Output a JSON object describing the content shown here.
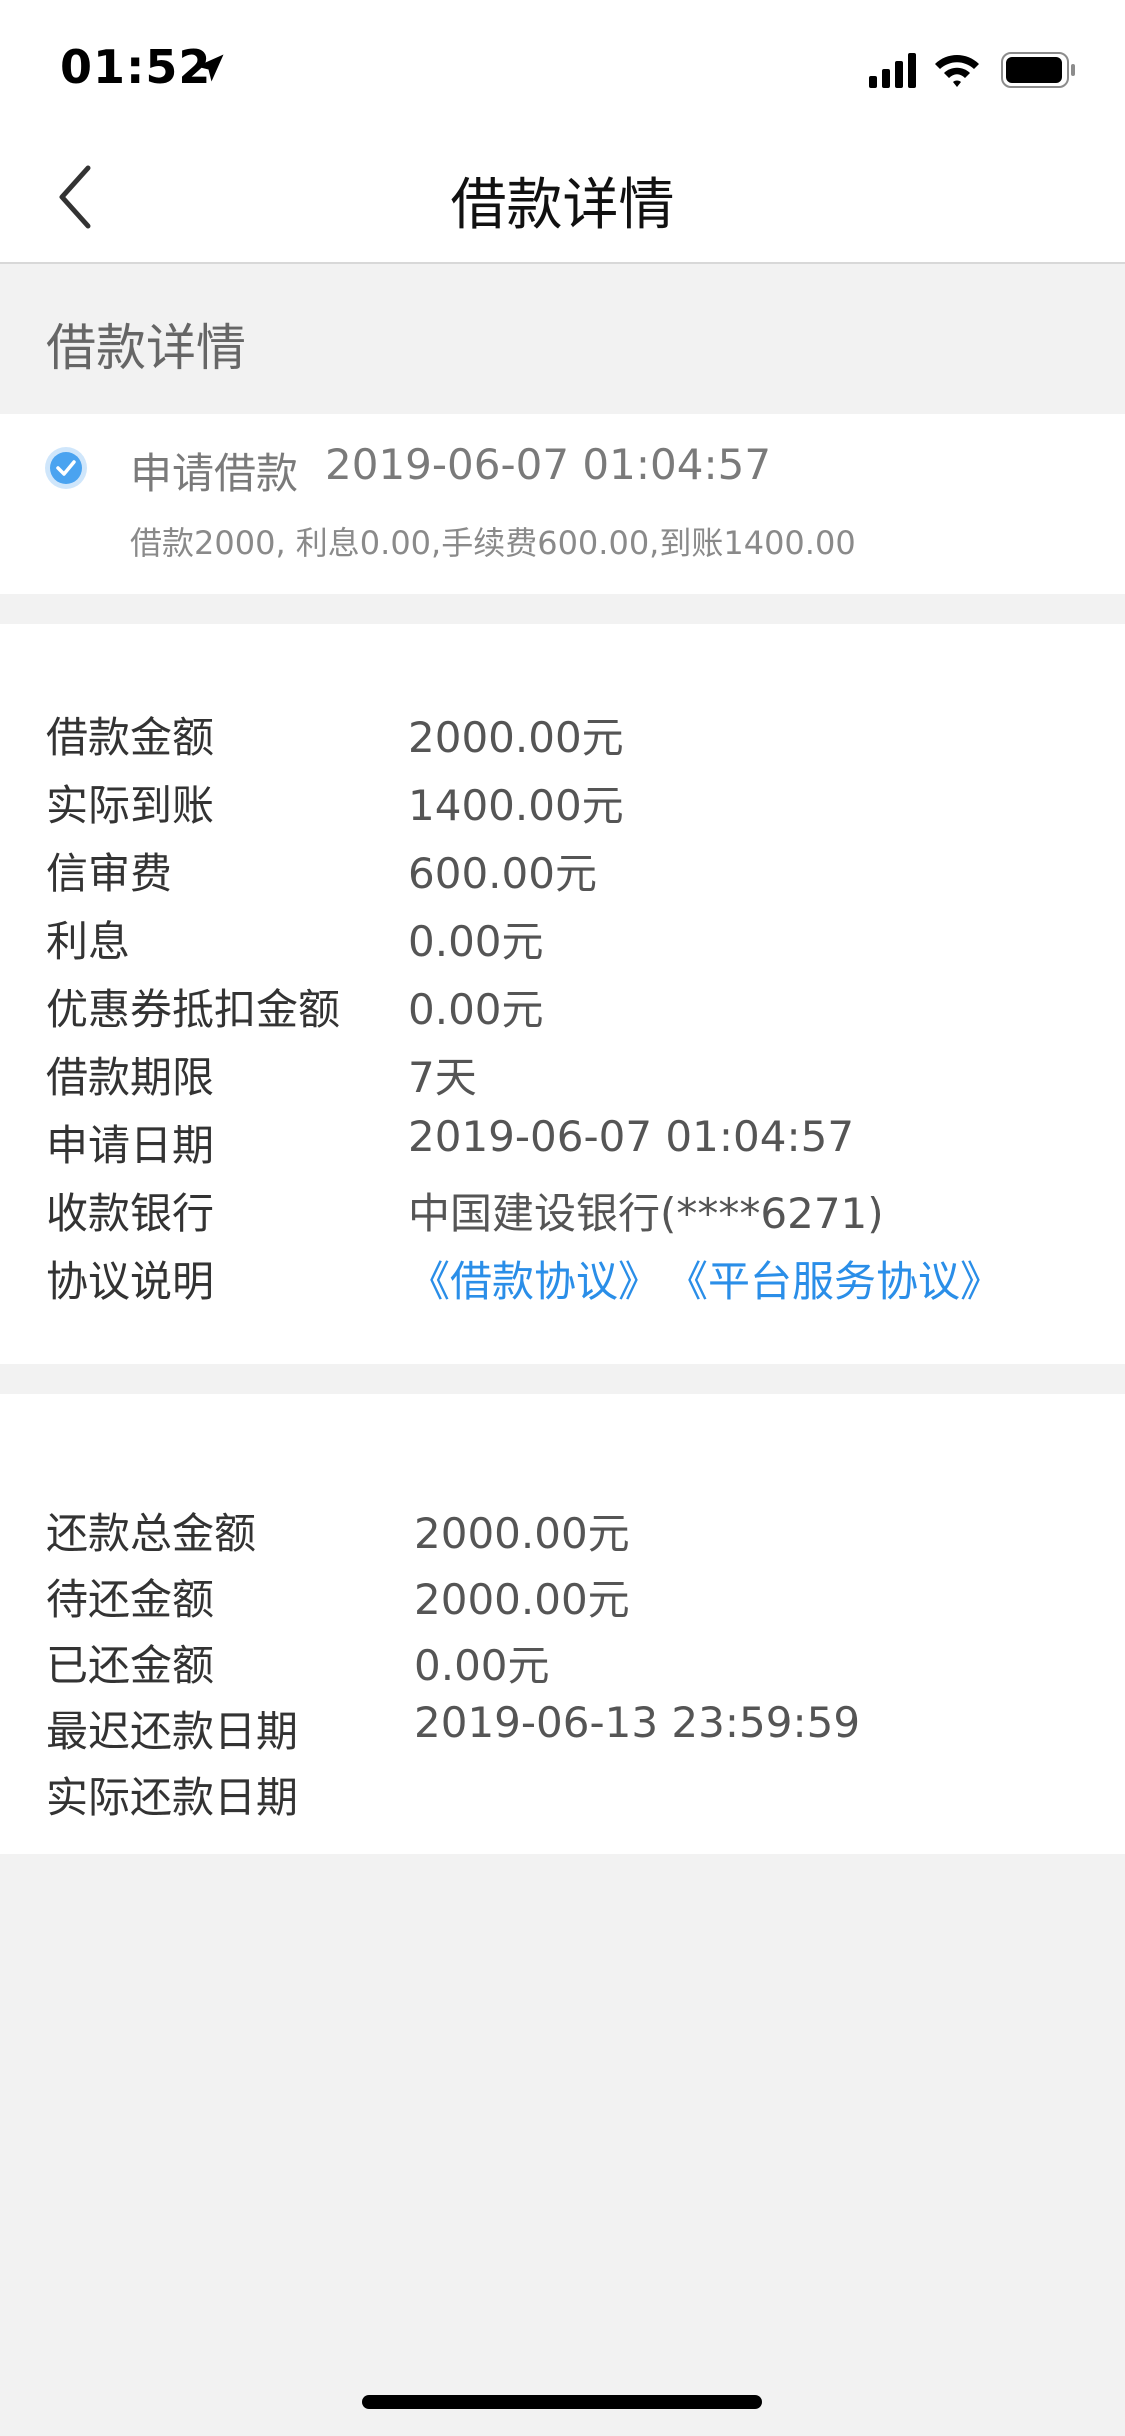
{
  "status_bar": {
    "time": "01:52"
  },
  "nav": {
    "title": "借款详情"
  },
  "section": {
    "title": "借款详情"
  },
  "event": {
    "title": "申请借款",
    "time": "2019-06-07 01:04:57",
    "description": "借款2000, 利息0.00,手续费600.00,到账1400.00"
  },
  "loan_details": {
    "rows": [
      {
        "label": "借款金额",
        "value": "2000.00元"
      },
      {
        "label": "实际到账",
        "value": "1400.00元"
      },
      {
        "label": "信审费",
        "value": "600.00元"
      },
      {
        "label": "利息",
        "value": "0.00元"
      },
      {
        "label": "优惠券抵扣金额",
        "value": "0.00元"
      },
      {
        "label": "借款期限",
        "value": "7天"
      },
      {
        "label": "申请日期",
        "value": "2019-06-07 01:04:57"
      },
      {
        "label": "收款银行",
        "value": "中国建设银行(****6271)"
      }
    ],
    "agreement_label": "协议说明",
    "agreement_links": [
      "《借款协议》",
      "《平台服务协议》"
    ]
  },
  "repayment_details": {
    "rows": [
      {
        "label": "还款总金额",
        "value": "2000.00元"
      },
      {
        "label": "待还金额",
        "value": "2000.00元"
      },
      {
        "label": "已还金额",
        "value": "0.00元"
      },
      {
        "label": "最迟还款日期",
        "value": "2019-06-13 23:59:59"
      },
      {
        "label": "实际还款日期",
        "value": ""
      }
    ]
  },
  "colors": {
    "accent": "#2a8ee8",
    "check": "#4aa3f0",
    "background": "#f2f2f2"
  }
}
